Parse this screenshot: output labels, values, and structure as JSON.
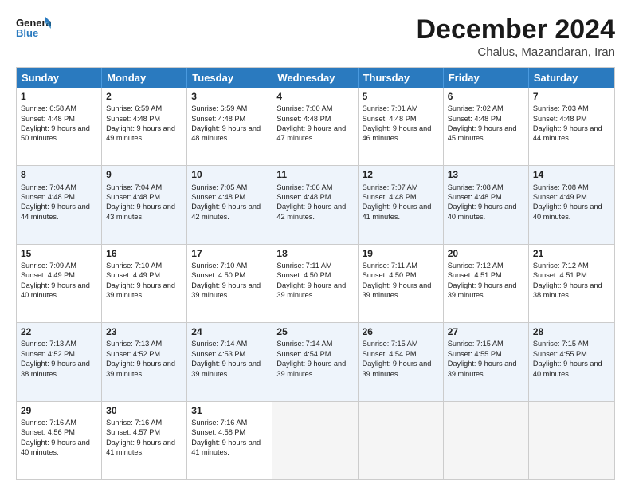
{
  "header": {
    "logo_general": "General",
    "logo_blue": "Blue",
    "month_title": "December 2024",
    "subtitle": "Chalus, Mazandaran, Iran"
  },
  "weekdays": [
    "Sunday",
    "Monday",
    "Tuesday",
    "Wednesday",
    "Thursday",
    "Friday",
    "Saturday"
  ],
  "rows": [
    [
      {
        "day": "1",
        "sunrise": "Sunrise: 6:58 AM",
        "sunset": "Sunset: 4:48 PM",
        "daylight": "Daylight: 9 hours and 50 minutes."
      },
      {
        "day": "2",
        "sunrise": "Sunrise: 6:59 AM",
        "sunset": "Sunset: 4:48 PM",
        "daylight": "Daylight: 9 hours and 49 minutes."
      },
      {
        "day": "3",
        "sunrise": "Sunrise: 6:59 AM",
        "sunset": "Sunset: 4:48 PM",
        "daylight": "Daylight: 9 hours and 48 minutes."
      },
      {
        "day": "4",
        "sunrise": "Sunrise: 7:00 AM",
        "sunset": "Sunset: 4:48 PM",
        "daylight": "Daylight: 9 hours and 47 minutes."
      },
      {
        "day": "5",
        "sunrise": "Sunrise: 7:01 AM",
        "sunset": "Sunset: 4:48 PM",
        "daylight": "Daylight: 9 hours and 46 minutes."
      },
      {
        "day": "6",
        "sunrise": "Sunrise: 7:02 AM",
        "sunset": "Sunset: 4:48 PM",
        "daylight": "Daylight: 9 hours and 45 minutes."
      },
      {
        "day": "7",
        "sunrise": "Sunrise: 7:03 AM",
        "sunset": "Sunset: 4:48 PM",
        "daylight": "Daylight: 9 hours and 44 minutes."
      }
    ],
    [
      {
        "day": "8",
        "sunrise": "Sunrise: 7:04 AM",
        "sunset": "Sunset: 4:48 PM",
        "daylight": "Daylight: 9 hours and 44 minutes."
      },
      {
        "day": "9",
        "sunrise": "Sunrise: 7:04 AM",
        "sunset": "Sunset: 4:48 PM",
        "daylight": "Daylight: 9 hours and 43 minutes."
      },
      {
        "day": "10",
        "sunrise": "Sunrise: 7:05 AM",
        "sunset": "Sunset: 4:48 PM",
        "daylight": "Daylight: 9 hours and 42 minutes."
      },
      {
        "day": "11",
        "sunrise": "Sunrise: 7:06 AM",
        "sunset": "Sunset: 4:48 PM",
        "daylight": "Daylight: 9 hours and 42 minutes."
      },
      {
        "day": "12",
        "sunrise": "Sunrise: 7:07 AM",
        "sunset": "Sunset: 4:48 PM",
        "daylight": "Daylight: 9 hours and 41 minutes."
      },
      {
        "day": "13",
        "sunrise": "Sunrise: 7:08 AM",
        "sunset": "Sunset: 4:48 PM",
        "daylight": "Daylight: 9 hours and 40 minutes."
      },
      {
        "day": "14",
        "sunrise": "Sunrise: 7:08 AM",
        "sunset": "Sunset: 4:49 PM",
        "daylight": "Daylight: 9 hours and 40 minutes."
      }
    ],
    [
      {
        "day": "15",
        "sunrise": "Sunrise: 7:09 AM",
        "sunset": "Sunset: 4:49 PM",
        "daylight": "Daylight: 9 hours and 40 minutes."
      },
      {
        "day": "16",
        "sunrise": "Sunrise: 7:10 AM",
        "sunset": "Sunset: 4:49 PM",
        "daylight": "Daylight: 9 hours and 39 minutes."
      },
      {
        "day": "17",
        "sunrise": "Sunrise: 7:10 AM",
        "sunset": "Sunset: 4:50 PM",
        "daylight": "Daylight: 9 hours and 39 minutes."
      },
      {
        "day": "18",
        "sunrise": "Sunrise: 7:11 AM",
        "sunset": "Sunset: 4:50 PM",
        "daylight": "Daylight: 9 hours and 39 minutes."
      },
      {
        "day": "19",
        "sunrise": "Sunrise: 7:11 AM",
        "sunset": "Sunset: 4:50 PM",
        "daylight": "Daylight: 9 hours and 39 minutes."
      },
      {
        "day": "20",
        "sunrise": "Sunrise: 7:12 AM",
        "sunset": "Sunset: 4:51 PM",
        "daylight": "Daylight: 9 hours and 39 minutes."
      },
      {
        "day": "21",
        "sunrise": "Sunrise: 7:12 AM",
        "sunset": "Sunset: 4:51 PM",
        "daylight": "Daylight: 9 hours and 38 minutes."
      }
    ],
    [
      {
        "day": "22",
        "sunrise": "Sunrise: 7:13 AM",
        "sunset": "Sunset: 4:52 PM",
        "daylight": "Daylight: 9 hours and 38 minutes."
      },
      {
        "day": "23",
        "sunrise": "Sunrise: 7:13 AM",
        "sunset": "Sunset: 4:52 PM",
        "daylight": "Daylight: 9 hours and 39 minutes."
      },
      {
        "day": "24",
        "sunrise": "Sunrise: 7:14 AM",
        "sunset": "Sunset: 4:53 PM",
        "daylight": "Daylight: 9 hours and 39 minutes."
      },
      {
        "day": "25",
        "sunrise": "Sunrise: 7:14 AM",
        "sunset": "Sunset: 4:54 PM",
        "daylight": "Daylight: 9 hours and 39 minutes."
      },
      {
        "day": "26",
        "sunrise": "Sunrise: 7:15 AM",
        "sunset": "Sunset: 4:54 PM",
        "daylight": "Daylight: 9 hours and 39 minutes."
      },
      {
        "day": "27",
        "sunrise": "Sunrise: 7:15 AM",
        "sunset": "Sunset: 4:55 PM",
        "daylight": "Daylight: 9 hours and 39 minutes."
      },
      {
        "day": "28",
        "sunrise": "Sunrise: 7:15 AM",
        "sunset": "Sunset: 4:55 PM",
        "daylight": "Daylight: 9 hours and 40 minutes."
      }
    ],
    [
      {
        "day": "29",
        "sunrise": "Sunrise: 7:16 AM",
        "sunset": "Sunset: 4:56 PM",
        "daylight": "Daylight: 9 hours and 40 minutes."
      },
      {
        "day": "30",
        "sunrise": "Sunrise: 7:16 AM",
        "sunset": "Sunset: 4:57 PM",
        "daylight": "Daylight: 9 hours and 41 minutes."
      },
      {
        "day": "31",
        "sunrise": "Sunrise: 7:16 AM",
        "sunset": "Sunset: 4:58 PM",
        "daylight": "Daylight: 9 hours and 41 minutes."
      },
      null,
      null,
      null,
      null
    ]
  ]
}
